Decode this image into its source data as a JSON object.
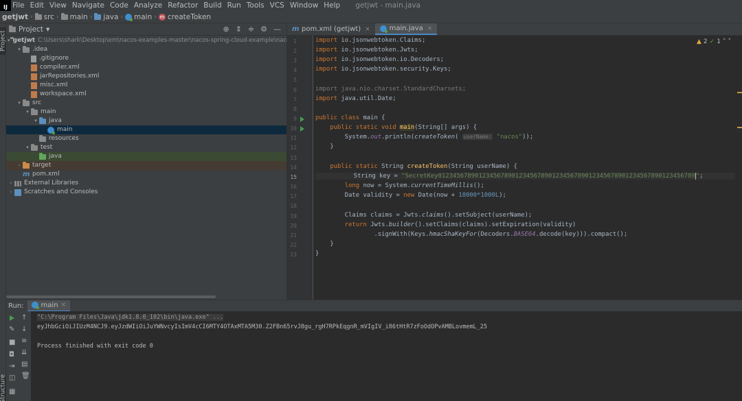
{
  "menubar": {
    "logo": "IJ",
    "items": [
      "File",
      "Edit",
      "View",
      "Navigate",
      "Code",
      "Analyze",
      "Refactor",
      "Build",
      "Run",
      "Tools",
      "VCS",
      "Window",
      "Help"
    ],
    "window_title": "getjwt - main.java"
  },
  "breadcrumb": {
    "project": "getjwt",
    "items": [
      "src",
      "main",
      "java",
      "main",
      "createToken"
    ]
  },
  "project_panel": {
    "title": "Project",
    "tree": [
      {
        "label": "getjwt",
        "path": "C:\\Users\\shark\\Desktop\\em\\nacos-examples-master\\nacos-spring-cloud-example\\nacos-spri",
        "indent": 0,
        "arrow": "▾",
        "icon": "folder"
      },
      {
        "label": ".idea",
        "indent": 1,
        "arrow": "▾",
        "icon": "folder"
      },
      {
        "label": ".gitignore",
        "indent": 2,
        "arrow": "",
        "icon": "file"
      },
      {
        "label": "compiler.xml",
        "indent": 2,
        "arrow": "",
        "icon": "xml"
      },
      {
        "label": "jarRepositories.xml",
        "indent": 2,
        "arrow": "",
        "icon": "xml"
      },
      {
        "label": "misc.xml",
        "indent": 2,
        "arrow": "",
        "icon": "xml"
      },
      {
        "label": "workspace.xml",
        "indent": 2,
        "arrow": "",
        "icon": "xml"
      },
      {
        "label": "src",
        "indent": 1,
        "arrow": "▾",
        "icon": "folder"
      },
      {
        "label": "main",
        "indent": 2,
        "arrow": "▾",
        "icon": "folder"
      },
      {
        "label": "java",
        "indent": 3,
        "arrow": "▾",
        "icon": "folder-blue"
      },
      {
        "label": "main",
        "indent": 4,
        "arrow": "",
        "icon": "class",
        "state": "selected"
      },
      {
        "label": "resources",
        "indent": 3,
        "arrow": "",
        "icon": "folder"
      },
      {
        "label": "test",
        "indent": 2,
        "arrow": "▾",
        "icon": "folder"
      },
      {
        "label": "java",
        "indent": 3,
        "arrow": "",
        "icon": "folder-green",
        "state": "test"
      },
      {
        "label": "target",
        "indent": 1,
        "arrow": "›",
        "icon": "folder-orange",
        "state": "target"
      },
      {
        "label": "pom.xml",
        "indent": 1,
        "arrow": "",
        "icon": "m"
      },
      {
        "label": "External Libraries",
        "indent": 0,
        "arrow": "›",
        "icon": "lib"
      },
      {
        "label": "Scratches and Consoles",
        "indent": 0,
        "arrow": "›",
        "icon": "scratch"
      }
    ]
  },
  "editor": {
    "tabs": [
      {
        "label": "pom.xml (getjwt)",
        "active": false
      },
      {
        "label": "main.java",
        "active": true
      }
    ],
    "inspections": {
      "warnings": "2",
      "ok": "1"
    },
    "line_numbers": [
      "1",
      "2",
      "3",
      "4",
      "5",
      "6",
      "7",
      "8",
      "9",
      "10",
      "11",
      "12",
      "13",
      "14",
      "15",
      "16",
      "17",
      "18",
      "19",
      "20",
      "21",
      "22",
      "23"
    ],
    "code": {
      "l1_kw": "import",
      "l1_rest": " io.jsonwebtoken.Claims;",
      "l2_kw": "import",
      "l2_rest": " io.jsonwebtoken.Jwts;",
      "l3_kw": "import",
      "l3_rest": " io.jsonwebtoken.io.Decoders;",
      "l4_kw": "import",
      "l4_rest": " io.jsonwebtoken.security.Keys;",
      "l6_dim": "import java.nio.charset.StandardCharsets;",
      "l7_kw": "import",
      "l7_rest": " java.util.Date;",
      "l9_kw": "public class",
      "l9_rest": " main {",
      "l10_kw": "public static void",
      "l10_fn": "main",
      "l10_rest": "(String[] args) {",
      "l11_a": "System.",
      "l11_out": "out",
      "l11_b": ".println(",
      "l11_call": "createToken",
      "l11_c": "( ",
      "l11_hint": "userName:",
      "l11_str": "\"nacos\"",
      "l11_d": "));",
      "l12": "}",
      "l14_kw": "public static",
      "l14_a": " String ",
      "l14_fn": "createToken",
      "l14_b": "(String userName) {",
      "l15_a": "String key = ",
      "l15_str": "\"SecretKey0123456789012345678901234567890123456789012345678901234567890123456789",
      "l15_str_end": "\"",
      "l15_end": ";",
      "l16_kw": "long",
      "l16_a": " now = System.",
      "l16_call": "currentTimeMillis",
      "l16_b": "();",
      "l17_a": "Date validity = ",
      "l17_kw": "new",
      "l17_b": " Date(now + ",
      "l17_num": "18000*1000L",
      "l17_c": ");",
      "l19_a": "Claims claims = Jwts.",
      "l19_call": "claims",
      "l19_b": "().setSubject(userName);",
      "l20_kw": "return",
      "l20_a": " Jwts.",
      "l20_call": "builder",
      "l20_b": "().setClaims(claims).setExpiration(validity)",
      "l21_a": ".signWith(Keys.",
      "l21_call": "hmacShaKeyFor",
      "l21_b": "(Decoders.",
      "l21_fld": "BASE64",
      "l21_c": ".decode(key))).compact();",
      "l22": "}",
      "l23": "}"
    }
  },
  "run_panel": {
    "label": "Run:",
    "tab": "main",
    "console": [
      "\"C:\\Program Files\\Java\\jdk1.8.0_102\\bin\\java.exe\" ...",
      "eyJhbGciOiJIUzM4NCJ9.eyJzdWIiOiJuYWNvcyIsImV4cCI6MTY4OTAxMTA5M30.Z2FBn65rvJ8gu_rgH7RPkEqgnR_mVIgIV_i86tHtR7zFoOdOPvAMBLovmemL_25",
      "Process finished with exit code 0"
    ]
  },
  "side_stripes": {
    "project": "Project",
    "structure": "Structure"
  }
}
